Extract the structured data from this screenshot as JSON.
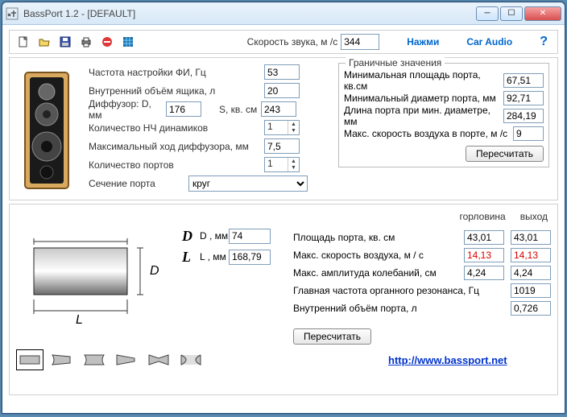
{
  "window": {
    "title": "BassPort 1.2 - [DEFAULT]"
  },
  "toolbar": {
    "speed_label": "Скорость звука, м /с",
    "speed_value": "344",
    "press": "Нажми",
    "caraudio": "Car Audio"
  },
  "inputs": {
    "tune_freq_label": "Частота настройки ФИ, Гц",
    "tune_freq": "53",
    "box_vol_label": "Внутренний объём ящика, л",
    "box_vol": "20",
    "diff_label": "Диффузор: D, мм",
    "diff_d": "176",
    "diff_s_label": "S, кв. см",
    "diff_s": "243",
    "nwoof_label": "Количество НЧ динамиков",
    "nwoof": "1",
    "xmax_label": "Максимальный ход диффузора, мм",
    "xmax": "7,5",
    "nports_label": "Количество портов",
    "nports": "1",
    "section_label": "Сечение порта",
    "section": "круг"
  },
  "limits": {
    "legend": "Граничные значения",
    "min_area_label": "Минимальная площадь порта, кв.см",
    "min_area": "67,51",
    "min_dia_label": "Минимальный диаметр порта, мм",
    "min_dia": "92,71",
    "len_mindia_label": "Длина порта при мин. диаметре, мм",
    "len_mindia": "284,19",
    "max_air_label": "Макс. скорость воздуха в порте, м /с",
    "max_air": "9",
    "recalc": "Пересчитать"
  },
  "port": {
    "d_label": "D , мм",
    "d_val": "74",
    "l_label": "L , мм",
    "l_val": "168,79"
  },
  "results": {
    "hdr_throat": "горловина",
    "hdr_mouth": "выход",
    "area_label": "Площадь порта, кв. см",
    "area_throat": "43,01",
    "area_mouth": "43,01",
    "vel_label": "Макс. скорость воздуха, м / с",
    "vel_throat": "14,13",
    "vel_mouth": "14,13",
    "amp_label": "Макс. амплитуда колебаний, см",
    "amp_throat": "4,24",
    "amp_mouth": "4,24",
    "organ_label": "Главная частота органного резонанса, Гц",
    "organ": "1019",
    "portvol_label": "Внутренний объём порта, л",
    "portvol": "0,726",
    "recalc": "Пересчитать"
  },
  "footer": {
    "url": "http://www.bassport.net"
  }
}
